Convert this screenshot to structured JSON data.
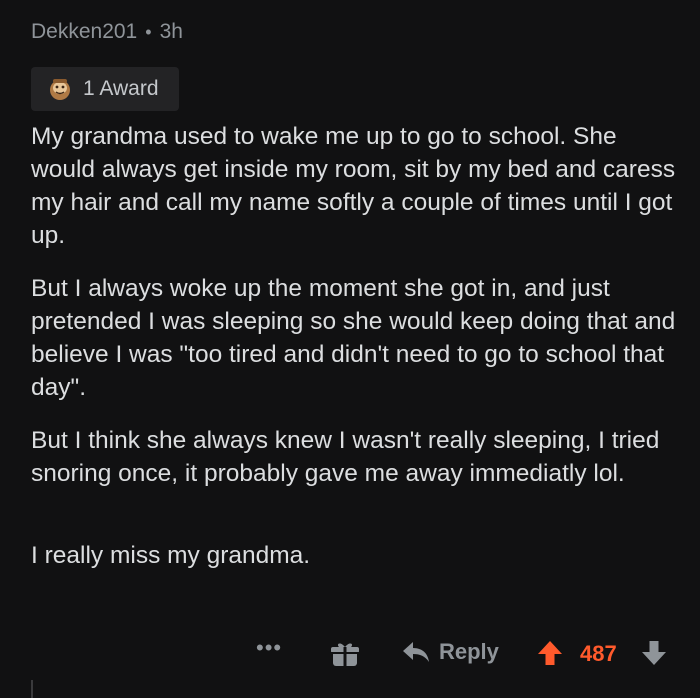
{
  "comment": {
    "username": "Dekken201",
    "separator": "•",
    "time": "3h",
    "award_label": "1 Award",
    "paragraphs": [
      "My grandma used to wake me up to go to school. She would always get inside my room, sit by my bed and caress my hair and call my name softly a couple of times until I got up.",
      "But I always woke up the moment she got in, and just pretended I was sleeping so she would keep doing that and believe I was \"too tired and didn't need to go to school that day\".",
      "But I think she always knew I wasn't really sleeping, I tried snoring once, it probably gave me away immediatly lol.",
      "I really miss my grandma."
    ]
  },
  "actions": {
    "more_label": "•••",
    "gift_icon": "gift-icon",
    "reply_label": "Reply",
    "score": "487",
    "upvote_icon": "upvote-arrow-icon",
    "downvote_icon": "downvote-arrow-icon"
  },
  "colors": {
    "background": "#111112",
    "text": "#dcdee0",
    "muted": "#8f9499",
    "upvote": "#ff5a2c"
  }
}
